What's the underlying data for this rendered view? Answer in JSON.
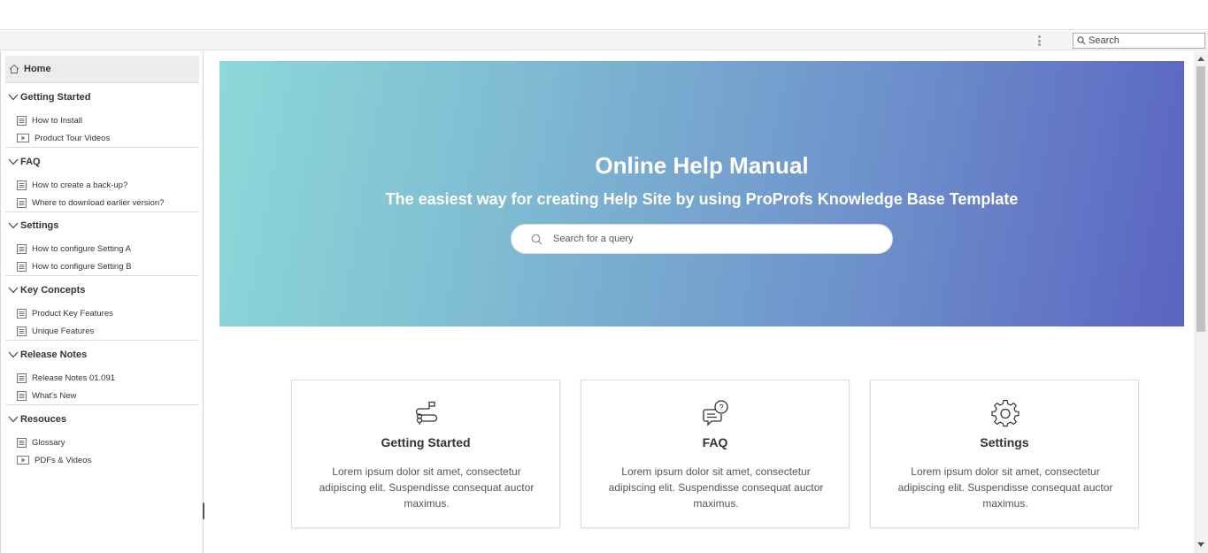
{
  "toolbar": {
    "search_placeholder": "Search"
  },
  "sidebar": {
    "home_label": "Home",
    "sections": [
      {
        "title": "Getting Started",
        "items": [
          {
            "label": "How to Install",
            "icon": "document-icon"
          },
          {
            "label": "Product Tour Videos",
            "icon": "video-icon"
          }
        ]
      },
      {
        "title": "FAQ",
        "items": [
          {
            "label": "How to create a back-up?",
            "icon": "document-icon"
          },
          {
            "label": "Where to download earlier version?",
            "icon": "document-icon"
          }
        ]
      },
      {
        "title": "Settings",
        "items": [
          {
            "label": "How to configure Setting A",
            "icon": "document-icon"
          },
          {
            "label": "How to configure Setting B",
            "icon": "document-icon"
          }
        ]
      },
      {
        "title": "Key Concepts",
        "items": [
          {
            "label": "Product Key Features",
            "icon": "document-icon"
          },
          {
            "label": "Unique Features",
            "icon": "document-icon"
          }
        ]
      },
      {
        "title": "Release Notes",
        "items": [
          {
            "label": "Release Notes 01.091",
            "icon": "document-icon"
          },
          {
            "label": "What's New",
            "icon": "document-icon"
          }
        ]
      },
      {
        "title": "Resouces",
        "items": [
          {
            "label": "Glossary",
            "icon": "document-icon"
          },
          {
            "label": "PDFs & Videos",
            "icon": "video-icon"
          }
        ]
      }
    ]
  },
  "hero": {
    "title": "Online Help Manual",
    "subtitle": "The easiest way for creating Help Site by using ProProfs Knowledge Base Template",
    "search_placeholder": "Search for a query",
    "gradient_colors": [
      "#8dd8d9",
      "#5a64c1"
    ]
  },
  "cards": [
    {
      "title": "Getting Started",
      "text": "Lorem ipsum dolor sit amet, consectetur adipiscing elit. Suspendisse consequat auctor maximus.",
      "icon": "roadmap-icon"
    },
    {
      "title": "FAQ",
      "text": "Lorem ipsum dolor sit amet, consectetur adipiscing elit. Suspendisse consequat auctor maximus.",
      "icon": "faq-chat-icon"
    },
    {
      "title": "Settings",
      "text": "Lorem ipsum dolor sit amet, consectetur adipiscing elit. Suspendisse consequat auctor maximus.",
      "icon": "gear-icon"
    }
  ]
}
